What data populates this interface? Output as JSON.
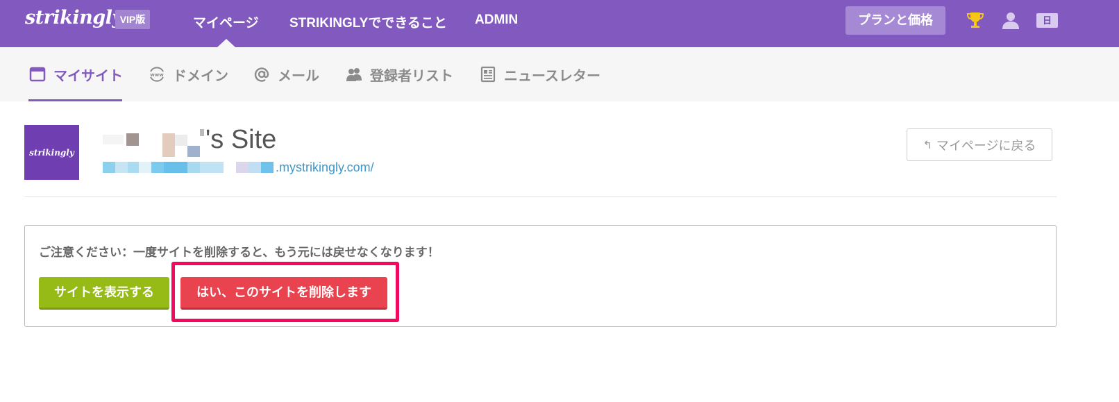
{
  "topbar": {
    "logo": "strikingly",
    "vip_badge": "VIP版",
    "nav": {
      "mypage": "マイページ",
      "features": "STRIKINGLYでできること",
      "admin": "ADMIN"
    },
    "plan_button": "プランと価格",
    "language": "日",
    "colors": {
      "background": "#8159bf",
      "trophy": "#f5c518"
    }
  },
  "subnav": {
    "tabs": [
      {
        "label": "マイサイト",
        "icon": "browser-window-icon",
        "active": true
      },
      {
        "label": "ドメイン",
        "icon": "www-globe-icon",
        "active": false
      },
      {
        "label": "メール",
        "icon": "at-sign-icon",
        "active": false
      },
      {
        "label": "登録者リスト",
        "icon": "users-icon",
        "active": false
      },
      {
        "label": "ニュースレター",
        "icon": "newsletter-icon",
        "active": false
      }
    ]
  },
  "site": {
    "thumbnail_label": "strikingly",
    "name_suffix": "'s Site",
    "url_suffix": ".mystrikingly.com/",
    "back_button": "マイページに戻る"
  },
  "warning_panel": {
    "message": "ご注意ください：一度サイトを削除すると、もう元には戻せなくなります！",
    "view_button": "サイトを表示する",
    "delete_button": "はい、このサイトを削除します",
    "colors": {
      "view": "#97bb16",
      "delete": "#e9434f",
      "highlight": "#ef0a5f"
    }
  }
}
